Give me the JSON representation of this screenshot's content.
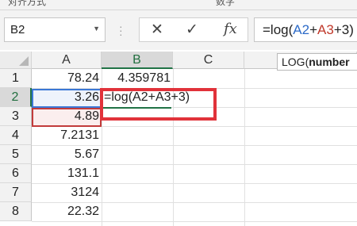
{
  "ribbon": {
    "cut_labels": [
      "对齐方式",
      "数字"
    ]
  },
  "namebox": {
    "value": "B2"
  },
  "formula_bar": {
    "cancel_symbol": "✕",
    "enter_symbol": "✓",
    "insert_function_symbol": "fx",
    "formula_parts": [
      "=log(",
      "A2",
      "+",
      "A3",
      "+3)"
    ]
  },
  "tooltip": {
    "func": "LOG(",
    "arg": "number"
  },
  "columns": [
    "A",
    "B",
    "C"
  ],
  "rows": [
    "1",
    "2",
    "3",
    "4",
    "5",
    "6",
    "7",
    "8"
  ],
  "cells": {
    "A": [
      "78.24",
      "3.26",
      "4.89",
      "7.2131",
      "5.67",
      "131.1",
      "3124",
      "22.32"
    ],
    "B1": "4.359781",
    "B2_edit": "=log(A2+A3+3)"
  },
  "colors": {
    "accent": "#217346",
    "ref_a2": "#3b78d6",
    "ref_a3": "#c23b3b",
    "highlight": "#e1323a"
  }
}
